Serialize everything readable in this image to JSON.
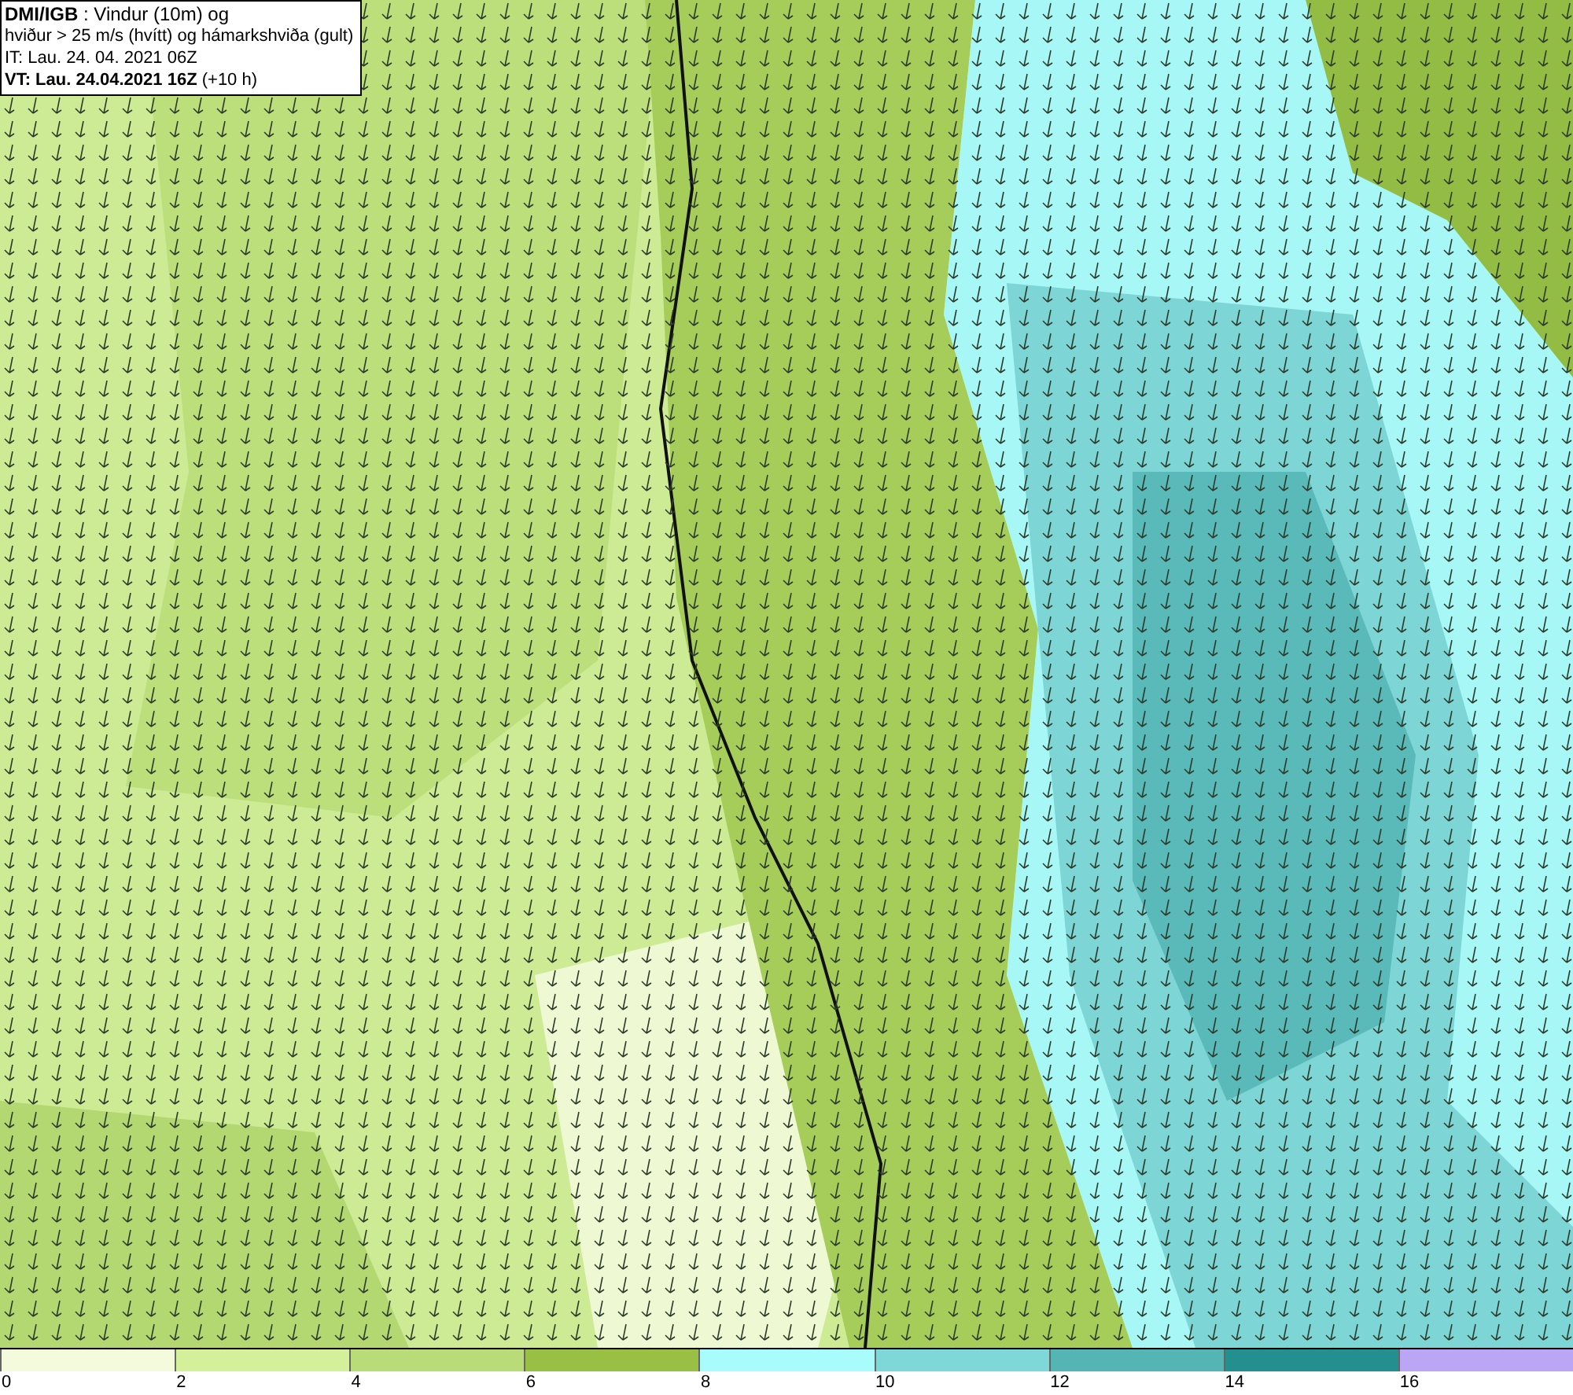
{
  "info_box": {
    "lines": [
      "**DMI/IGB** : Vindur (10m) og",
      "hviður > 25 m/s (hvítt) og hámarkshviða (gult)",
      "IT: Lau. 24. 04. 2021 06Z",
      "**VT: Lau. 24.04.2021 16Z** (+10 h)"
    ]
  },
  "legend": {
    "bins": [
      {
        "color": "#f4fbdc",
        "label": "0"
      },
      {
        "color": "#d5f09a",
        "label": "2"
      },
      {
        "color": "#b9dc78",
        "label": "4"
      },
      {
        "color": "#99bf45",
        "label": "6"
      },
      {
        "color": "#a8fcfc",
        "label": "8"
      },
      {
        "color": "#7fd8d8",
        "label": "10"
      },
      {
        "color": "#55b5b5",
        "label": "12"
      },
      {
        "color": "#238f8f",
        "label": "14"
      },
      {
        "color": "#baa6f5",
        "label": "16"
      }
    ]
  }
}
